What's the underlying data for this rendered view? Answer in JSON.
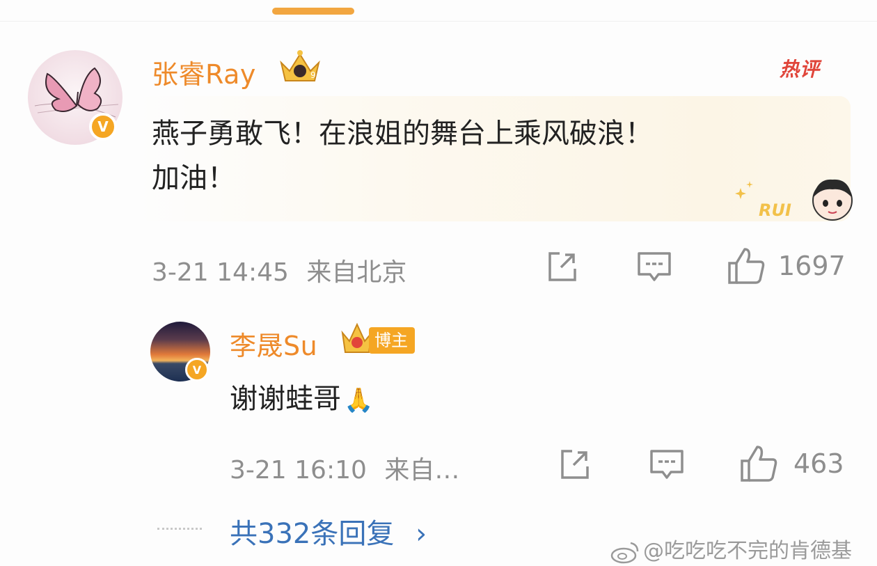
{
  "comment": {
    "username": "张睿Ray",
    "hot_label": "热评",
    "content_line1": "燕子勇敢飞！在浪姐的舞台上乘风破浪！",
    "content_line2": "加油！",
    "sticker_text": "RUI",
    "timestamp": "3-21 14:45",
    "location": "来自北京",
    "like_count": "1697",
    "verified_icon": "v-badge-icon"
  },
  "reply": {
    "username": "李晟Su",
    "host_tag": "博主",
    "content": "谢谢蛙哥",
    "emoji": "🙏",
    "timestamp": "3-21 16:10",
    "location": "来自…",
    "like_count": "463"
  },
  "more_replies": {
    "label": "共332条回复",
    "chevron": "›"
  },
  "watermark": {
    "text": "@吃吃吃不完的肯德基"
  },
  "colors": {
    "username": "#ee8a2a",
    "link": "#3a72b8",
    "accent": "#f5a623",
    "hot": "#e0453a"
  }
}
